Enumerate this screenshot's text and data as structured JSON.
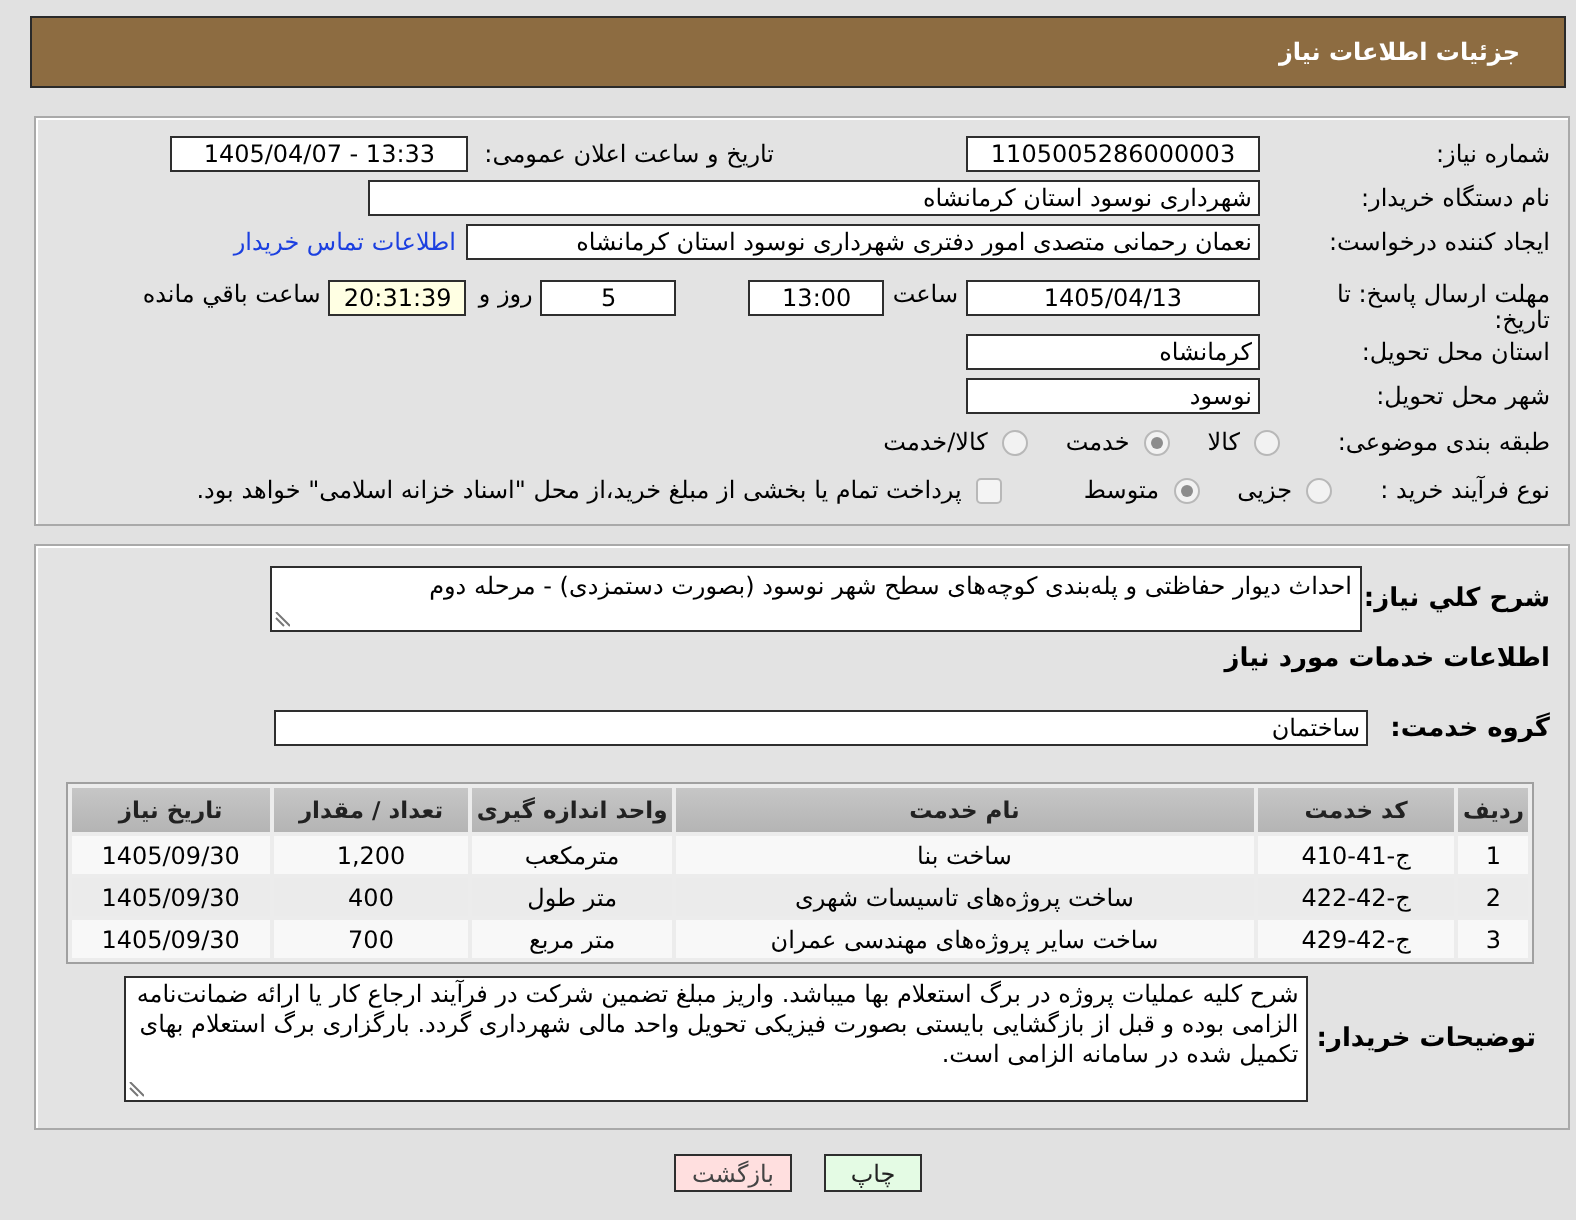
{
  "header": {
    "title": "جزئیات اطلاعات نیاز"
  },
  "details": {
    "need_number": {
      "label": "شماره نیاز:",
      "value": "1105005286000003"
    },
    "announcement": {
      "label": "تاریخ و ساعت اعلان عمومی:",
      "value": "1405/04/07 - 13:33"
    },
    "buyer_org": {
      "label": "نام دستگاه خریدار:",
      "value": "شهرداری نوسود استان کرمانشاه"
    },
    "requester": {
      "label": "ایجاد کننده درخواست:",
      "value": "نعمان رحمانی متصدی امور دفتری شهرداری نوسود استان کرمانشاه",
      "contact_link": "اطلاعات تماس خریدار"
    },
    "deadline": {
      "label": "مهلت ارسال پاسخ: تا تاریخ:",
      "date": "1405/04/13",
      "time_label": "ساعت",
      "time": "13:00",
      "days": "5",
      "days_label": "روز و",
      "remaining": "20:31:39",
      "remaining_label": "ساعت باقي مانده"
    },
    "province": {
      "label": "استان محل تحویل:",
      "value": "کرمانشاه"
    },
    "city": {
      "label": "شهر محل تحویل:",
      "value": "نوسود"
    },
    "category": {
      "label": "طبقه بندی موضوعی:",
      "options": [
        {
          "label": "کالا",
          "selected": false
        },
        {
          "label": "خدمت",
          "selected": true
        },
        {
          "label": "کالا/خدمت",
          "selected": false
        }
      ]
    },
    "process": {
      "label": "نوع فرآیند خرید :",
      "options": [
        {
          "label": "جزیی",
          "selected": false
        },
        {
          "label": "متوسط",
          "selected": true
        }
      ],
      "treasury": {
        "label": "پرداخت تمام یا بخشی از مبلغ خرید،از محل \"اسناد خزانه اسلامی\" خواهد بود.",
        "checked": false
      }
    }
  },
  "need": {
    "label": "شرح کلي نياز:",
    "value": "احداث دیوار حفاظتی و پله‌بندی کوچه‌های سطح شهر نوسود (بصورت دستمزدی) - مرحله دوم"
  },
  "services": {
    "title": "اطلاعات خدمات مورد نیاز",
    "group": {
      "label": "گروه خدمت:",
      "value": "ساختمان"
    },
    "table": {
      "columns": [
        "ردیف",
        "کد خدمت",
        "نام خدمت",
        "واحد اندازه گیری",
        "تعداد / مقدار",
        "تاریخ نیاز"
      ],
      "rows": [
        [
          "1",
          "ج-41-410",
          "ساخت بنا",
          "مترمکعب",
          "1,200",
          "1405/09/30"
        ],
        [
          "2",
          "ج-42-422",
          "ساخت پروژه‌های تاسیسات شهری",
          "متر طول",
          "400",
          "1405/09/30"
        ],
        [
          "3",
          "ج-42-429",
          "ساخت سایر پروژه‌های مهندسی عمران",
          "متر مربع",
          "700",
          "1405/09/30"
        ]
      ]
    }
  },
  "buyer_notes": {
    "label": "توضیحات خریدار:",
    "value": "شرح کلیه عملیات پروژه در برگ استعلام بها میباشد. واریز مبلغ تضمین شرکت در فرآیند ارجاع کار یا ارائه ضمانت‌نامه الزامی بوده و قبل از بازگشایی بایستی بصورت فیزیکی تحویل واحد مالی شهرداری گردد. بارگزاری برگ استعلام بهای تکمیل شده در سامانه الزامی است."
  },
  "buttons": [
    {
      "label": "چاپ",
      "kind": "print"
    },
    {
      "label": "بازگشت",
      "kind": "back"
    }
  ]
}
